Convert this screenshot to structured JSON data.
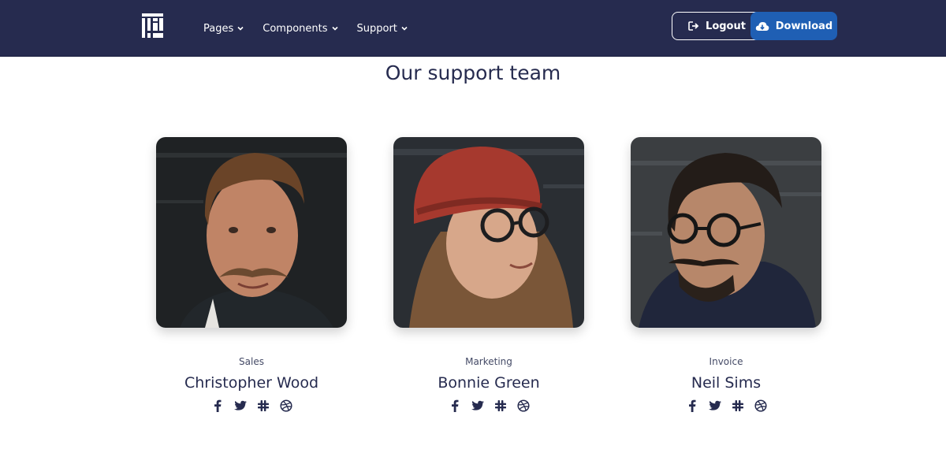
{
  "nav": {
    "items": [
      {
        "label": "Pages"
      },
      {
        "label": "Components"
      },
      {
        "label": "Support"
      }
    ],
    "logout_label": "Logout",
    "download_label": "Download"
  },
  "section": {
    "title": "Our support team"
  },
  "team": [
    {
      "role": "Sales",
      "name": "Christopher Wood",
      "socials": [
        "facebook-icon",
        "twitter-icon",
        "slack-icon",
        "dribbble-icon"
      ]
    },
    {
      "role": "Marketing",
      "name": "Bonnie Green",
      "socials": [
        "facebook-icon",
        "twitter-icon",
        "slack-icon",
        "dribbble-icon"
      ]
    },
    {
      "role": "Invoice",
      "name": "Neil Sims",
      "socials": [
        "facebook-icon",
        "twitter-icon",
        "slack-icon",
        "dribbble-icon"
      ]
    }
  ],
  "colors": {
    "navbar": "#262b4f",
    "accent": "#1f5fb4",
    "text": "#262b4f"
  }
}
